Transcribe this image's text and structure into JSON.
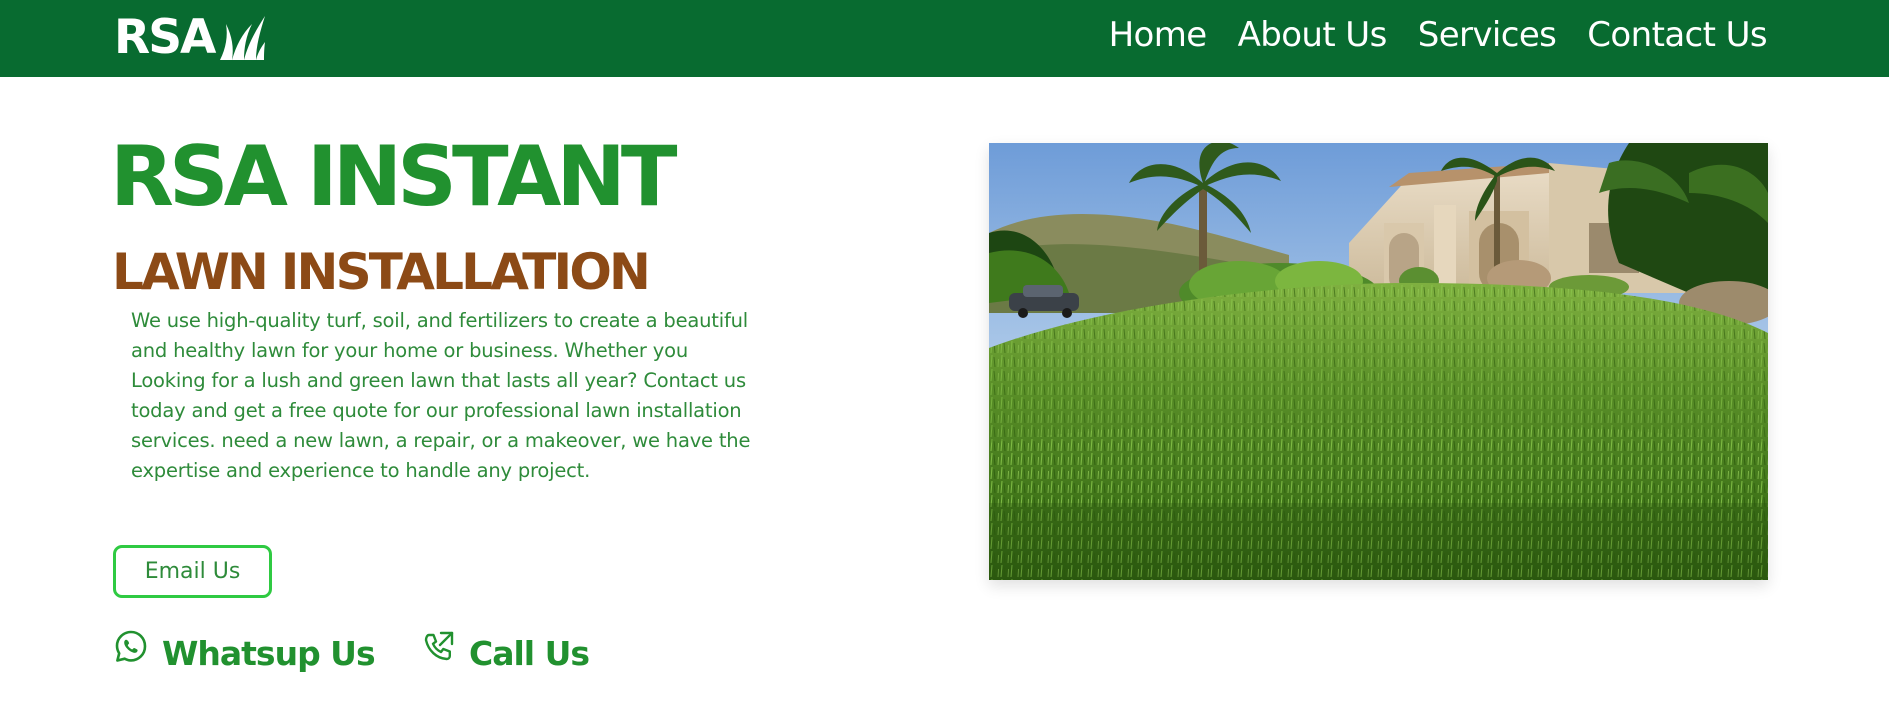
{
  "brand": {
    "name": "RSA",
    "logo_icon": "grass-blades-icon"
  },
  "nav": {
    "items": [
      {
        "label": "Home"
      },
      {
        "label": "About Us"
      },
      {
        "label": "Services"
      },
      {
        "label": "Contact Us"
      }
    ]
  },
  "hero": {
    "title": "RSA INSTANT",
    "subtitle": "LAWN INSTALLATION",
    "description": "We use high-quality turf, soil, and fertilizers to create a beautiful and healthy lawn for your home or business. Whether you Looking for a lush and green lawn that lasts all year? Contact us today and get a free quote for our professional lawn installation services. need a new lawn, a repair, or a makeover, we have the expertise and experience to handle any project.",
    "email_button": "Email Us",
    "whatsapp_label": "Whatsup Us",
    "whatsapp_icon": "whatsapp-icon",
    "call_label": "Call Us",
    "call_icon": "phone-outgoing-icon",
    "image_subject": "lush green lawn in front of a house with palm trees"
  },
  "colors": {
    "nav_bg": "#086b30",
    "title_green": "#21912f",
    "subtitle_brown": "#8c4a16",
    "text_green": "#2e8b3a",
    "button_border": "#2fca42"
  }
}
